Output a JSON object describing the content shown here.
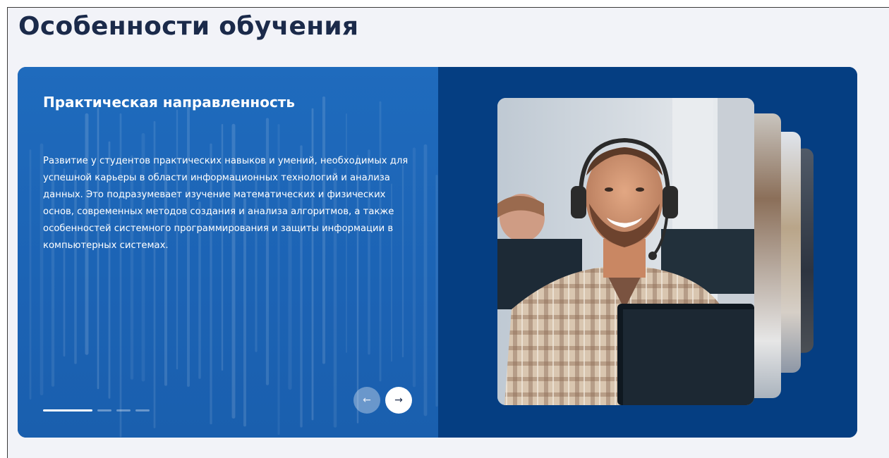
{
  "section": {
    "title": "Особенности обучения"
  },
  "slide": {
    "title": "Практическая направленность",
    "text": "Развитие у студентов практических навыков и умений, необходимых для успешной карьеры в области информационных технологий и анализа данных. Это подразумевает изучение математических и физических основ, современных методов создания и анализа алгоритмов, а также особенностей системного программирования и защиты информации в компьютерных системах.",
    "photo_description_icon": "person-with-headset-photo"
  },
  "pager": {
    "total": 4,
    "active_index": 0
  },
  "nav": {
    "prev_icon": "←",
    "next_icon": "→"
  },
  "colors": {
    "page_bg": "#f2f3f8",
    "title": "#1b2a4a",
    "slide_left_bg": "#1f6bbd",
    "slide_right_bg": "#053e82"
  }
}
